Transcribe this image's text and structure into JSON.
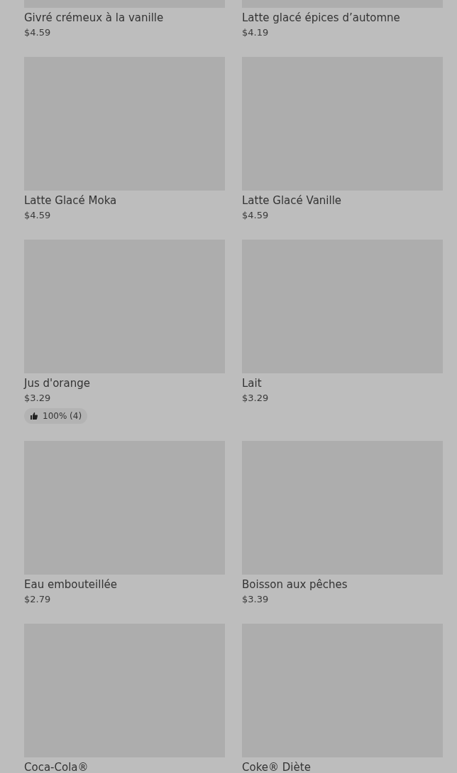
{
  "products": [
    {
      "name": "Givré crémeux à la vanille",
      "price": "$4.59"
    },
    {
      "name": "Latte glacé épices d’automne",
      "price": "$4.19"
    },
    {
      "name": "Latte Glacé Moka",
      "price": "$4.59"
    },
    {
      "name": "Latte Glacé Vanille",
      "price": "$4.59"
    },
    {
      "name": "Jus d'orange",
      "price": "$3.29",
      "rating": "100% (4)"
    },
    {
      "name": "Lait",
      "price": "$3.29"
    },
    {
      "name": "Eau embouteillée",
      "price": "$2.79"
    },
    {
      "name": "Boisson aux pêches",
      "price": "$3.39"
    },
    {
      "name": "Coca-Cola®"
    },
    {
      "name": "Coke® Diète"
    }
  ]
}
